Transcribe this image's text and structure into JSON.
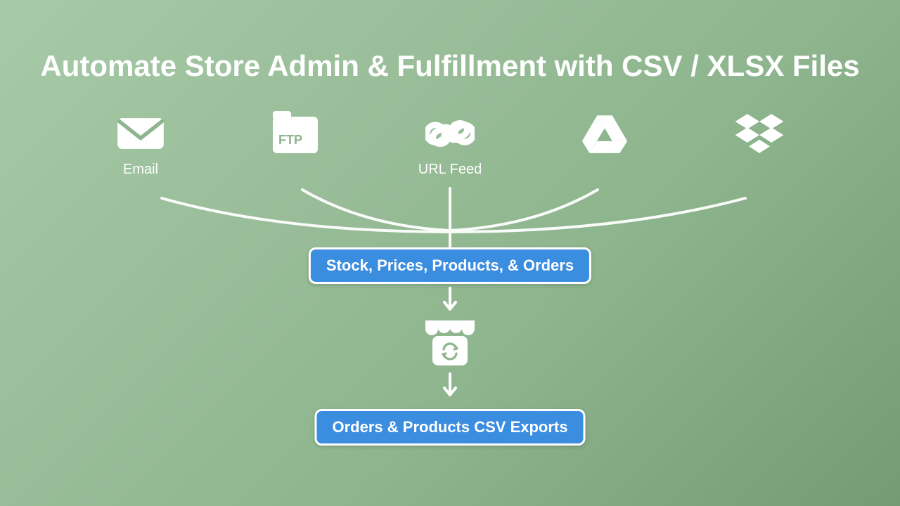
{
  "title": "Automate Store Admin & Fulfillment with CSV / XLSX Files",
  "sources": {
    "email": {
      "label": "Email"
    },
    "ftp": {
      "folder_text": "FTP",
      "label": ""
    },
    "url": {
      "label": "URL Feed"
    },
    "gdrive": {
      "label": ""
    },
    "dropbox": {
      "label": ""
    }
  },
  "pill_imports": "Stock, Prices, Products, & Orders",
  "pill_exports": "Orders & Products CSV Exports",
  "colors": {
    "accent": "#3b8de0",
    "icon": "#ffffff"
  }
}
